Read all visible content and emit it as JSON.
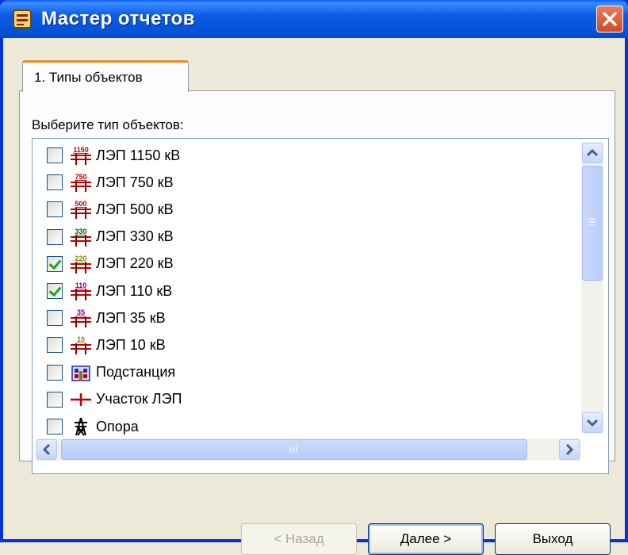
{
  "window": {
    "title": "Мастер отчетов"
  },
  "tabs": [
    {
      "label": "1. Типы объектов",
      "selected": true
    }
  ],
  "prompt": "Выберите тип объектов:",
  "items": [
    {
      "label": "ЛЭП 1150 кВ",
      "checked": false,
      "icon": "power-line-icon",
      "badge": "1150",
      "badge_color": "#c00000"
    },
    {
      "label": "ЛЭП 750 кВ",
      "checked": false,
      "icon": "power-line-icon",
      "badge": "750",
      "badge_color": "#c00000"
    },
    {
      "label": "ЛЭП 500 кВ",
      "checked": false,
      "icon": "power-line-icon",
      "badge": "500",
      "badge_color": "#c00000"
    },
    {
      "label": "ЛЭП 330 кВ",
      "checked": false,
      "icon": "power-line-icon",
      "badge": "330",
      "badge_color": "#006400"
    },
    {
      "label": "ЛЭП 220 кВ",
      "checked": true,
      "icon": "power-line-icon",
      "badge": "220",
      "badge_color": "#808000"
    },
    {
      "label": "ЛЭП 110 кВ",
      "checked": true,
      "icon": "power-line-icon",
      "badge": "110",
      "badge_color": "#800080"
    },
    {
      "label": "ЛЭП 35 кВ",
      "checked": false,
      "icon": "power-line-icon",
      "badge": "35",
      "badge_color": "#800080"
    },
    {
      "label": "ЛЭП 10 кВ",
      "checked": false,
      "icon": "power-line-icon",
      "badge": "10",
      "badge_color": "#808000"
    },
    {
      "label": "Подстанция",
      "checked": false,
      "icon": "substation-icon"
    },
    {
      "label": "Участок ЛЭП",
      "checked": false,
      "icon": "line-section-icon"
    },
    {
      "label": "Опора",
      "checked": false,
      "icon": "pylon-icon"
    }
  ],
  "buttons": {
    "back": "< Назад",
    "next": "Далее >",
    "exit": "Выход"
  }
}
